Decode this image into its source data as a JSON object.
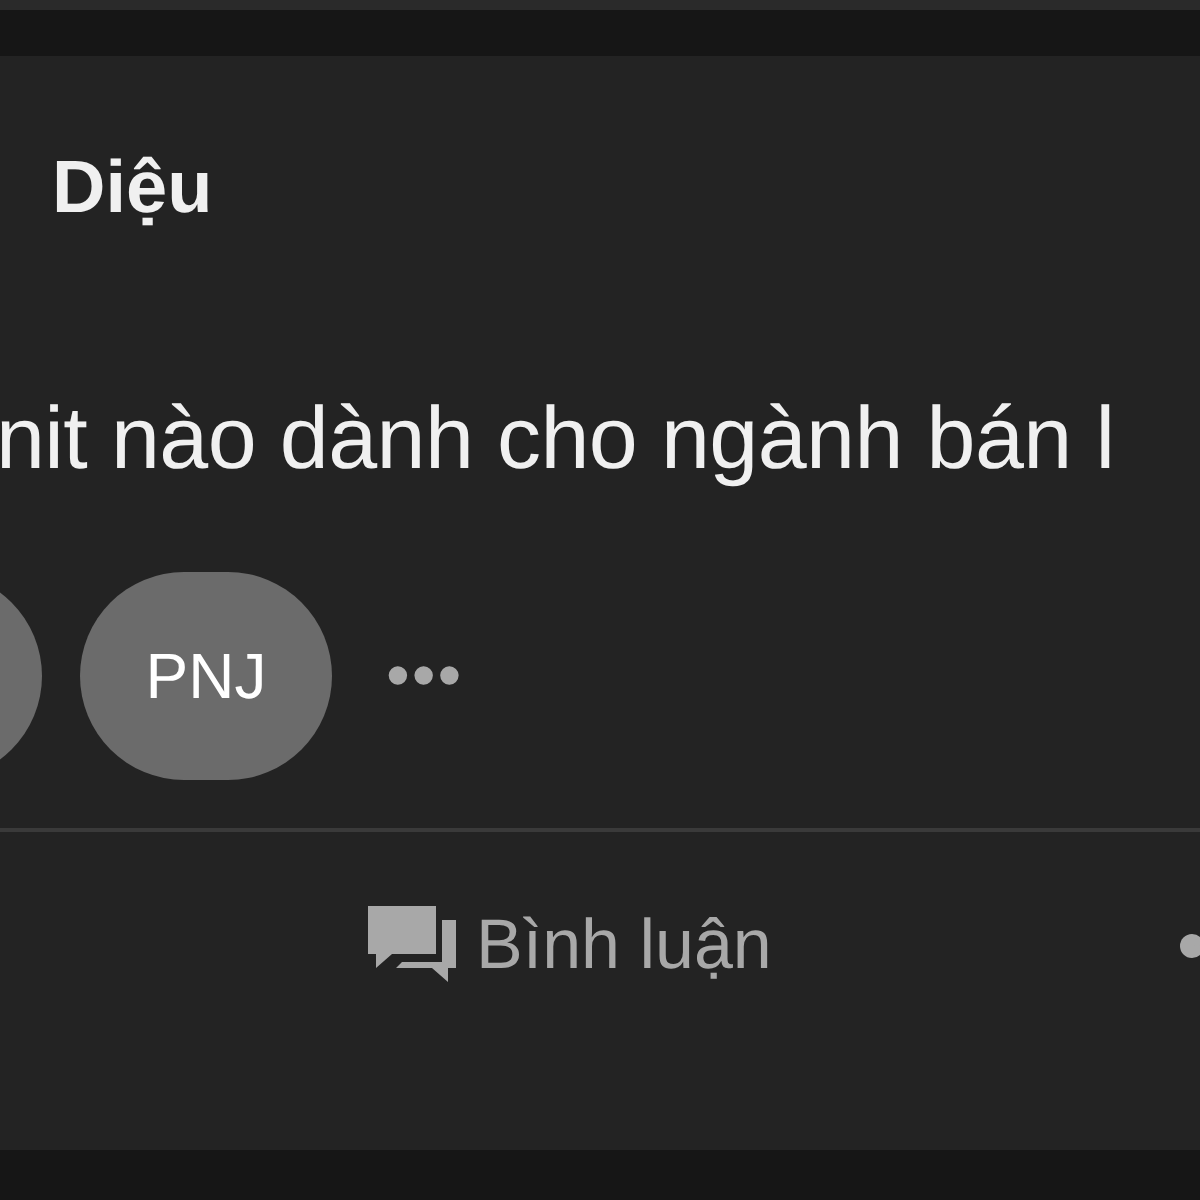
{
  "post": {
    "author": "Diệu",
    "text": "nit nào dành cho ngành bán l",
    "tags": [
      {
        "kind": "partial"
      },
      {
        "kind": "full",
        "label": "PNJ"
      }
    ],
    "more": "•••",
    "actions": [
      {
        "kind": "comment",
        "label": "Bình luận"
      },
      {
        "kind": "share"
      }
    ]
  }
}
